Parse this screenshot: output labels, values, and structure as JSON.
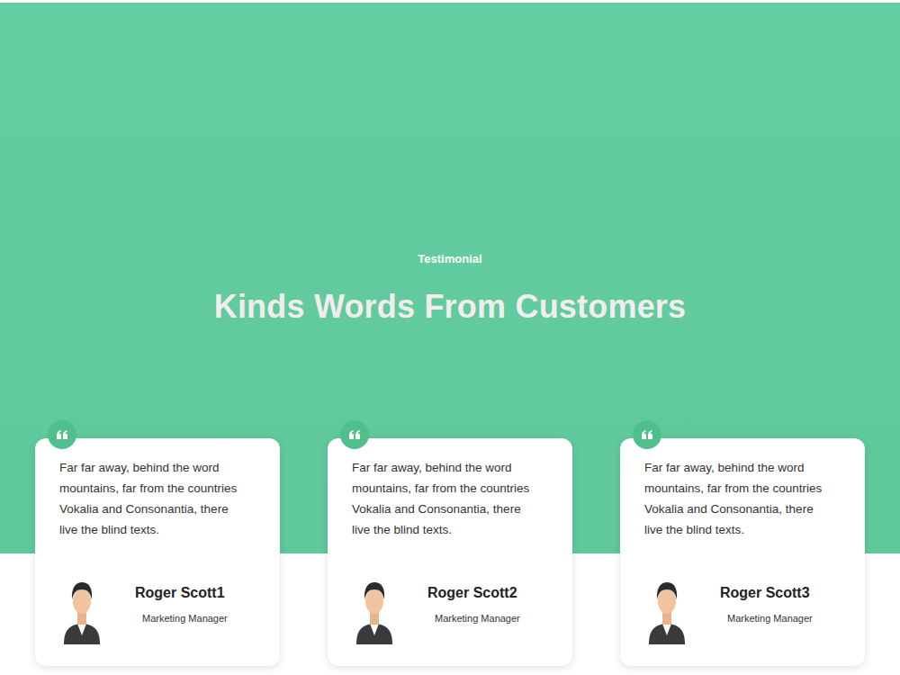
{
  "hero": {
    "subtitle": "Testimonial",
    "title": "Kinds Words From Customers"
  },
  "testimonials": [
    {
      "text": "Far far away, behind the word mountains, far from the countries Vokalia and Consonantia, there live the blind texts.",
      "name": "Roger Scott1",
      "role": "Marketing Manager"
    },
    {
      "text": "Far far away, behind the word mountains, far from the countries Vokalia and Consonantia, there live the blind texts.",
      "name": "Roger Scott2",
      "role": "Marketing Manager"
    },
    {
      "text": "Far far away, behind the word mountains, far from the countries Vokalia and Consonantia, there live the blind texts.",
      "name": "Roger Scott3",
      "role": "Marketing Manager"
    }
  ]
}
